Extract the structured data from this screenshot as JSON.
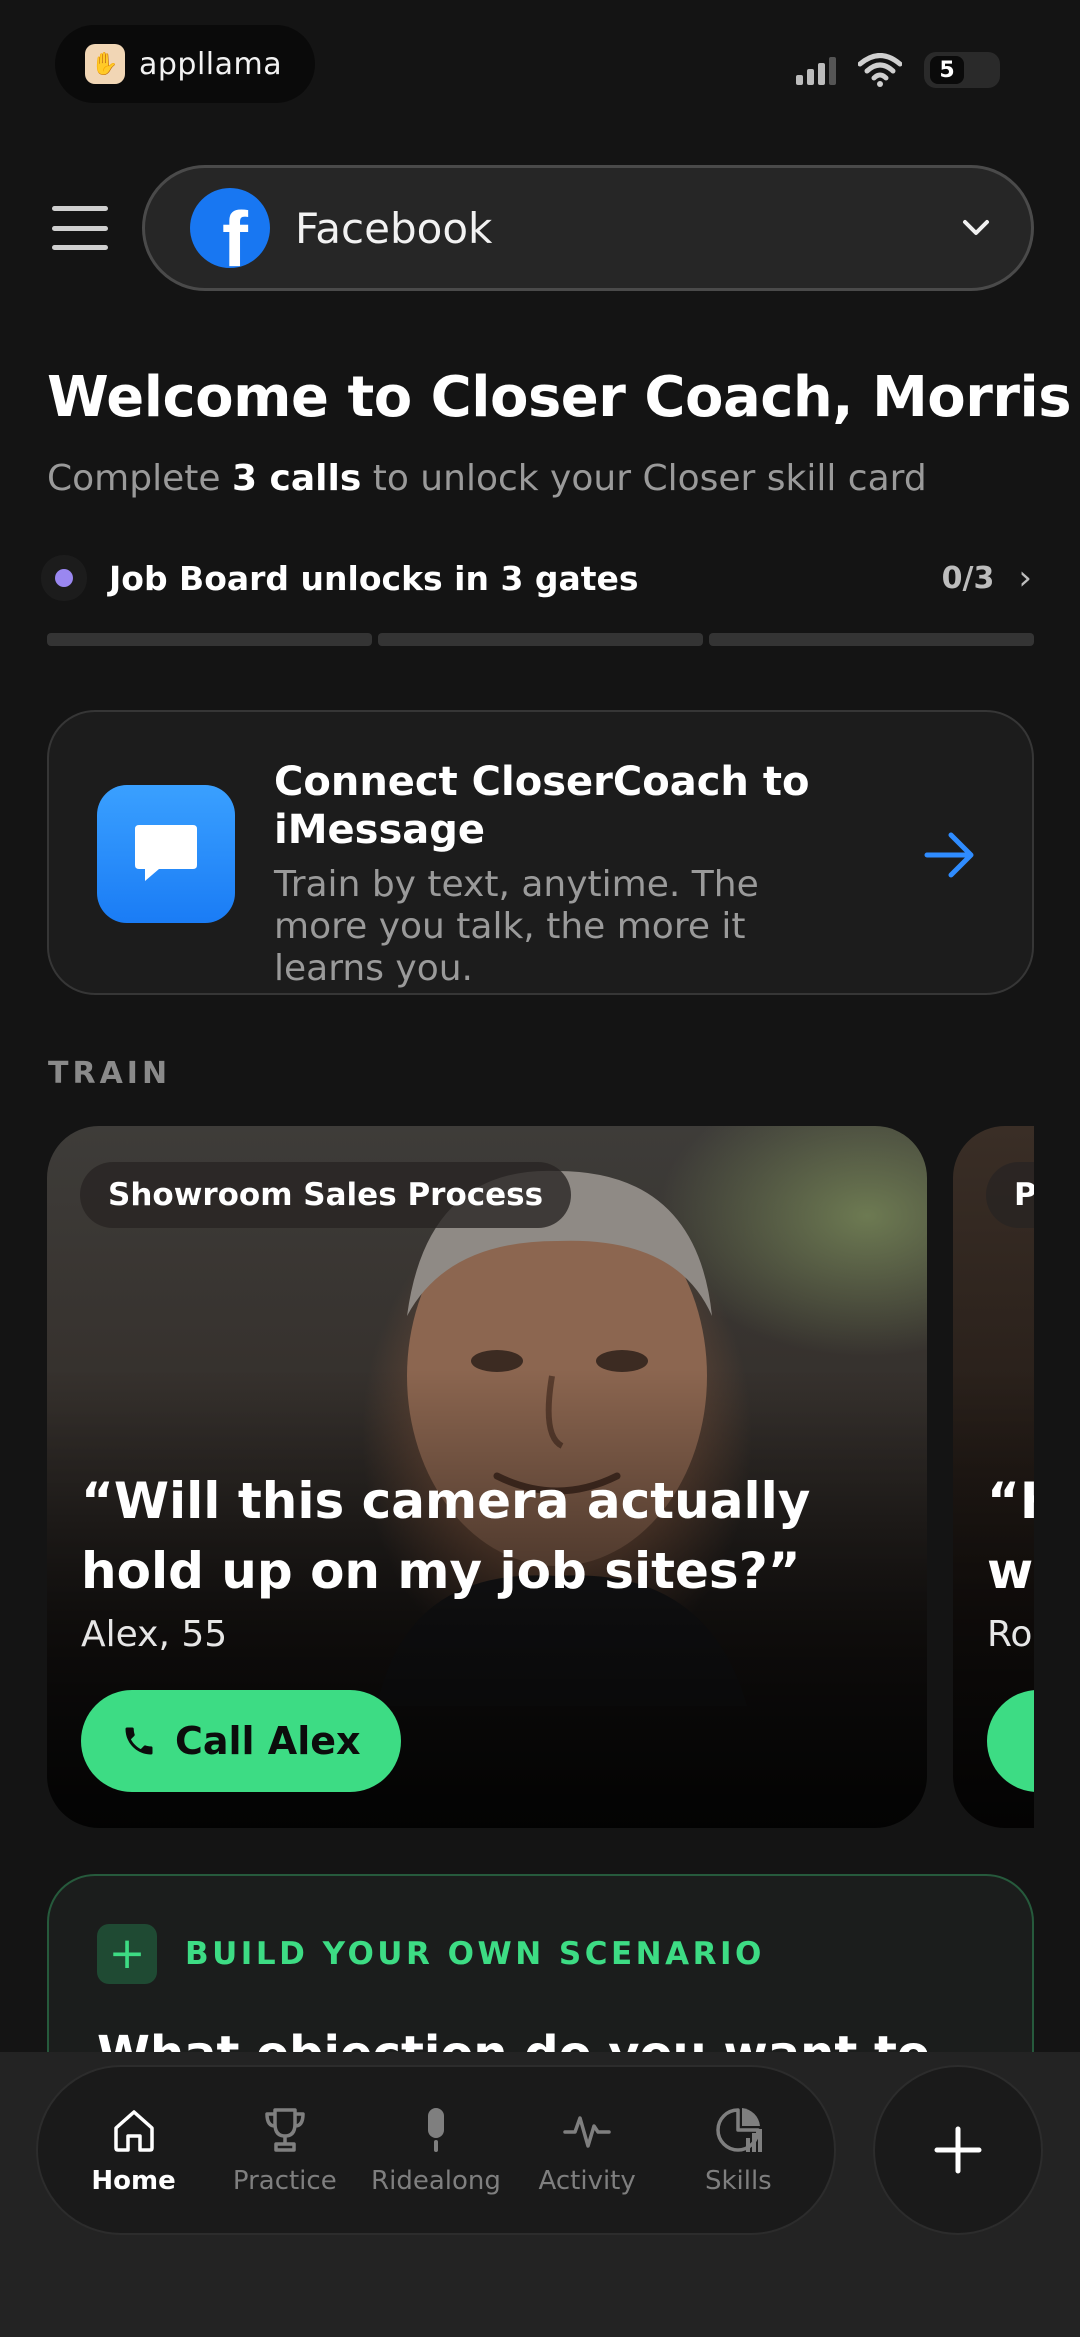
{
  "status_bar": {
    "app_name": "appllama",
    "battery_level": "5"
  },
  "header": {
    "account_name": "Facebook",
    "account_icon": "facebook-icon"
  },
  "welcome": {
    "title": "Welcome to Closer Coach, Morris",
    "sub_prefix": "Complete ",
    "sub_bold": "3 calls",
    "sub_suffix": " to unlock your Closer skill card"
  },
  "gates": {
    "label": "Job Board unlocks in 3 gates",
    "count": "0/3",
    "dot_color": "#9a87f0",
    "progress_completed": 0,
    "progress_total": 3
  },
  "imessage": {
    "title": "Connect CloserCoach to iMessage",
    "description": "Train by text, anytime. The more you talk, the more it learns you."
  },
  "train": {
    "section_label": "TRAIN",
    "cards": [
      {
        "tag": "Showroom Sales Process",
        "quote": "“Will this camera actually hold up on my job sites?”",
        "persona": "Alex, 55",
        "cta": "Call Alex"
      },
      {
        "tag": "P",
        "quote": "“H w",
        "persona": "Ro"
      }
    ]
  },
  "build": {
    "label": "BUILD YOUR OWN SCENARIO",
    "question": "What objection do you want to"
  },
  "nav": {
    "tabs": [
      {
        "label": "Home",
        "icon": "home-icon"
      },
      {
        "label": "Practice",
        "icon": "trophy-icon"
      },
      {
        "label": "Ridealong",
        "icon": "microphone-icon"
      },
      {
        "label": "Activity",
        "icon": "activity-icon"
      },
      {
        "label": "Skills",
        "icon": "skills-chart-icon"
      }
    ],
    "active_tab": "Home"
  },
  "colors": {
    "accent_green": "#3ddc84",
    "facebook_blue": "#1877f2",
    "imessage_blue": "#1a7cf5",
    "background": "#141414"
  }
}
